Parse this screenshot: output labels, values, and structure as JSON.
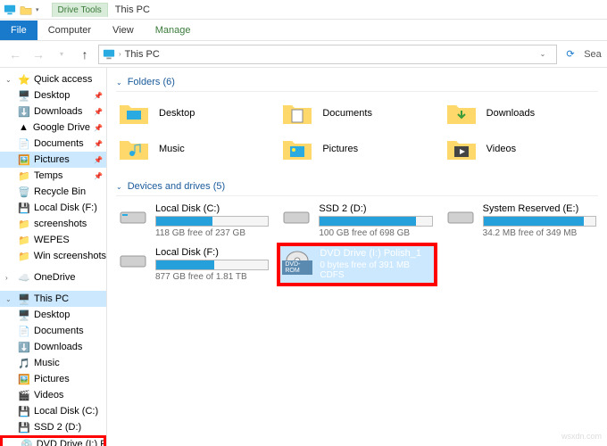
{
  "titlebar": {
    "context_tab": "Drive Tools",
    "title": "This PC"
  },
  "ribbon": {
    "file": "File",
    "tabs": [
      "Computer",
      "View",
      "Manage"
    ]
  },
  "address": {
    "crumb1": "This PC",
    "search_placeholder": "Sea"
  },
  "sidebar": {
    "quick_access": {
      "label": "Quick access",
      "items": [
        {
          "label": "Desktop",
          "pinned": true
        },
        {
          "label": "Downloads",
          "pinned": true
        },
        {
          "label": "Google Drive",
          "pinned": true
        },
        {
          "label": "Documents",
          "pinned": true
        },
        {
          "label": "Pictures",
          "pinned": true
        },
        {
          "label": "Temps",
          "pinned": true
        },
        {
          "label": "Recycle Bin",
          "pinned": false
        },
        {
          "label": "Local Disk (F:)",
          "pinned": false
        },
        {
          "label": "screenshots",
          "pinned": false
        },
        {
          "label": "WEPES",
          "pinned": false
        },
        {
          "label": "Win screenshots",
          "pinned": false
        }
      ]
    },
    "onedrive": {
      "label": "OneDrive"
    },
    "this_pc": {
      "label": "This PC",
      "items": [
        {
          "label": "Desktop"
        },
        {
          "label": "Documents"
        },
        {
          "label": "Downloads"
        },
        {
          "label": "Music"
        },
        {
          "label": "Pictures"
        },
        {
          "label": "Videos"
        },
        {
          "label": "Local Disk (C:)"
        },
        {
          "label": "SSD 2 (D:)"
        },
        {
          "label": "DVD Drive (I:) Polish"
        }
      ]
    }
  },
  "sections": {
    "folders": {
      "title": "Folders (6)",
      "items": [
        {
          "name": "Desktop",
          "type": "desktop"
        },
        {
          "name": "Documents",
          "type": "documents"
        },
        {
          "name": "Downloads",
          "type": "downloads"
        },
        {
          "name": "Music",
          "type": "music"
        },
        {
          "name": "Pictures",
          "type": "pictures"
        },
        {
          "name": "Videos",
          "type": "videos"
        }
      ]
    },
    "drives": {
      "title": "Devices and drives (5)",
      "items": [
        {
          "name": "Local Disk (C:)",
          "status": "118 GB free of 237 GB",
          "fill": 50,
          "type": "hdd"
        },
        {
          "name": "SSD 2 (D:)",
          "status": "100 GB free of 698 GB",
          "fill": 86,
          "type": "hdd"
        },
        {
          "name": "System Reserved (E:)",
          "status": "34.2 MB free of 349 MB",
          "fill": 90,
          "type": "hdd"
        },
        {
          "name": "Local Disk (F:)",
          "status": "877 GB free of 1.81 TB",
          "fill": 52,
          "type": "hdd"
        },
        {
          "name": "DVD Drive (I:) Polish_1",
          "status": "0 bytes free of 391 MB",
          "sub": "CDFS",
          "type": "dvd",
          "selected": true,
          "badge": "DVD-ROM"
        }
      ]
    }
  },
  "watermark": "wsxdn.com"
}
